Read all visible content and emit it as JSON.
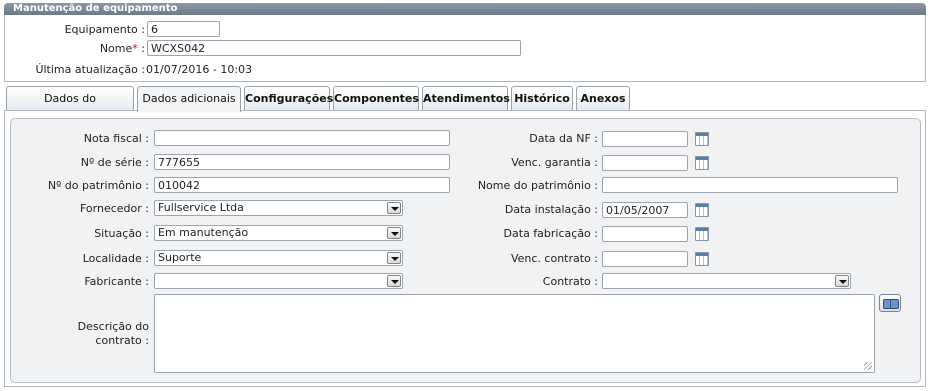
{
  "header": {
    "title": "Manutenção de equipamento",
    "equipamento_label": "Equipamento :",
    "equipamento_value": "6",
    "nome_label": "Nome",
    "nome_required": "*",
    "nome_colon": ":",
    "nome_value": "WCXS042",
    "ultima_label": "Última atualização :",
    "ultima_value": "01/07/2016 - 10:03"
  },
  "tabs": [
    {
      "label": "Dados do equipamento"
    },
    {
      "label": "Dados adicionais"
    },
    {
      "label": "Configurações"
    },
    {
      "label": "Componentes"
    },
    {
      "label": "Atendimentos"
    },
    {
      "label": "Histórico"
    },
    {
      "label": "Anexos"
    }
  ],
  "form": {
    "nota_fiscal": {
      "label": "Nota fiscal :",
      "value": ""
    },
    "numero_serie": {
      "label": "Nº de série :",
      "value": "777655"
    },
    "numero_patrimonio": {
      "label": "Nº do patrimônio :",
      "value": "010042"
    },
    "fornecedor": {
      "label": "Fornecedor :",
      "value": "Fullservice Ltda"
    },
    "situacao": {
      "label": "Situação :",
      "value": "Em manutenção"
    },
    "localidade": {
      "label": "Localidade :",
      "value": "Suporte"
    },
    "fabricante": {
      "label": "Fabricante :",
      "value": ""
    },
    "descricao_contrato": {
      "label_line1": "Descrição do",
      "label_line2": "contrato :",
      "value": ""
    },
    "data_nf": {
      "label": "Data da NF :",
      "value": ""
    },
    "venc_garantia": {
      "label": "Venc. garantia :",
      "value": ""
    },
    "nome_patrimonio": {
      "label": "Nome do patrimônio :",
      "value": ""
    },
    "data_instalacao": {
      "label": "Data instalação :",
      "value": "01/05/2007"
    },
    "data_fabricacao": {
      "label": "Data fabricação :",
      "value": ""
    },
    "venc_contrato": {
      "label": "Venc. contrato :",
      "value": ""
    },
    "contrato": {
      "label": "Contrato :",
      "value": ""
    }
  },
  "icons": {
    "calendar": "calendar-icon",
    "dropdown": "chevron-down-icon",
    "lookup": "book-icon",
    "resize": "resize-grip-icon"
  },
  "colors": {
    "header_bar": "#7a8797",
    "required": "#dd0000",
    "panel_bg": "#f1f2f4"
  }
}
